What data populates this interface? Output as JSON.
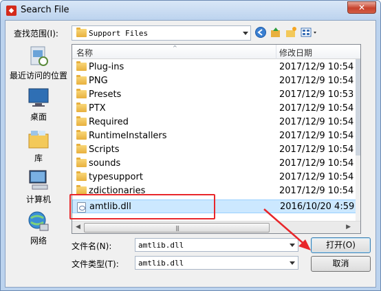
{
  "window": {
    "title": "Search File",
    "close_label": "✕"
  },
  "toolbar": {
    "look_in_label": "查找范围(I):",
    "look_in_value": "Support Files"
  },
  "places": [
    {
      "label": "最近访问的位置",
      "icon": "recent-places-icon"
    },
    {
      "label": "桌面",
      "icon": "desktop-icon"
    },
    {
      "label": "库",
      "icon": "library-icon"
    },
    {
      "label": "计算机",
      "icon": "computer-icon"
    },
    {
      "label": "网络",
      "icon": "network-icon"
    }
  ],
  "columns": {
    "name": "名称",
    "modified": "修改日期"
  },
  "files": [
    {
      "name": "Plug-ins",
      "date": "2017/12/9 10:54",
      "type": "folder"
    },
    {
      "name": "PNG",
      "date": "2017/12/9 10:54",
      "type": "folder"
    },
    {
      "name": "Presets",
      "date": "2017/12/9 10:53",
      "type": "folder"
    },
    {
      "name": "PTX",
      "date": "2017/12/9 10:54",
      "type": "folder"
    },
    {
      "name": "Required",
      "date": "2017/12/9 10:54",
      "type": "folder"
    },
    {
      "name": "RuntimeInstallers",
      "date": "2017/12/9 10:54",
      "type": "folder"
    },
    {
      "name": "Scripts",
      "date": "2017/12/9 10:54",
      "type": "folder"
    },
    {
      "name": "sounds",
      "date": "2017/12/9 10:54",
      "type": "folder"
    },
    {
      "name": "typesupport",
      "date": "2017/12/9 10:54",
      "type": "folder"
    },
    {
      "name": "zdictionaries",
      "date": "2017/12/9 10:54",
      "type": "folder"
    },
    {
      "name": "amtlib.dll",
      "date": "2016/10/20 4:59",
      "type": "dll"
    }
  ],
  "form": {
    "file_name_label": "文件名(N):",
    "file_name_value": "amtlib.dll",
    "file_type_label": "文件类型(T):",
    "file_type_value": "amtlib.dll"
  },
  "buttons": {
    "open": "打开(O)",
    "cancel": "取消"
  },
  "colors": {
    "highlight": "#e8262a",
    "selection": "#cce8ff"
  }
}
